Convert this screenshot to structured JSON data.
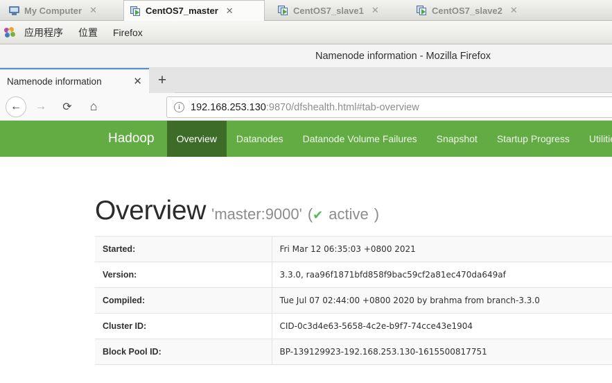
{
  "vmware": {
    "tabs": [
      {
        "label": "My Computer",
        "icon": "monitor-icon",
        "active": false,
        "close": "✕"
      },
      {
        "label": "CentOS7_master",
        "icon": "vm-icon",
        "active": true,
        "close": "✕"
      },
      {
        "label": "CentOS7_slave1",
        "icon": "vm-icon",
        "active": false,
        "close": "✕"
      },
      {
        "label": "CentOS7_slave2",
        "icon": "vm-icon",
        "active": false,
        "close": "✕"
      }
    ]
  },
  "gnome_panel": {
    "items": [
      "应用程序",
      "位置",
      "Firefox"
    ]
  },
  "firefox": {
    "window_title": "Namenode information - Mozilla Firefox",
    "tab_title": "Namenode information",
    "tab_close": "✕",
    "new_tab": "+",
    "back": "←",
    "forward": "→",
    "reload": "⟳",
    "home": "⌂",
    "url_info_icon": "i",
    "url_host": "192.168.253.130",
    "url_rest": ":9870/dfshealth.html#tab-overview"
  },
  "hadoop": {
    "brand": "Hadoop",
    "nav": [
      {
        "label": "Overview",
        "active": true
      },
      {
        "label": "Datanodes",
        "active": false
      },
      {
        "label": "Datanode Volume Failures",
        "active": false
      },
      {
        "label": "Snapshot",
        "active": false
      },
      {
        "label": "Startup Progress",
        "active": false
      },
      {
        "label": "Utilities",
        "active": false,
        "dropdown": true
      }
    ],
    "nav_color": "#63ab43",
    "nav_active_color": "#3d6b28",
    "heading": {
      "title": "Overview",
      "subtitle": "'master:9000'",
      "status_open": "(",
      "status_check": "✔",
      "status_text": "active",
      "status_close": ")",
      "status_color": "#5cb85c"
    },
    "overview_rows": [
      {
        "key": "Started:",
        "value": "Fri Mar 12 06:35:03 +0800 2021"
      },
      {
        "key": "Version:",
        "value": "3.3.0, raa96f1871bfd858f9bac59cf2a81ec470da649af"
      },
      {
        "key": "Compiled:",
        "value": "Tue Jul 07 02:44:00 +0800 2020 by brahma from branch-3.3.0"
      },
      {
        "key": "Cluster ID:",
        "value": "CID-0c3d4e63-5658-4c2e-b9f7-74cce43e1904"
      },
      {
        "key": "Block Pool ID:",
        "value": "BP-139129923-192.168.253.130-1615500817751"
      }
    ]
  }
}
